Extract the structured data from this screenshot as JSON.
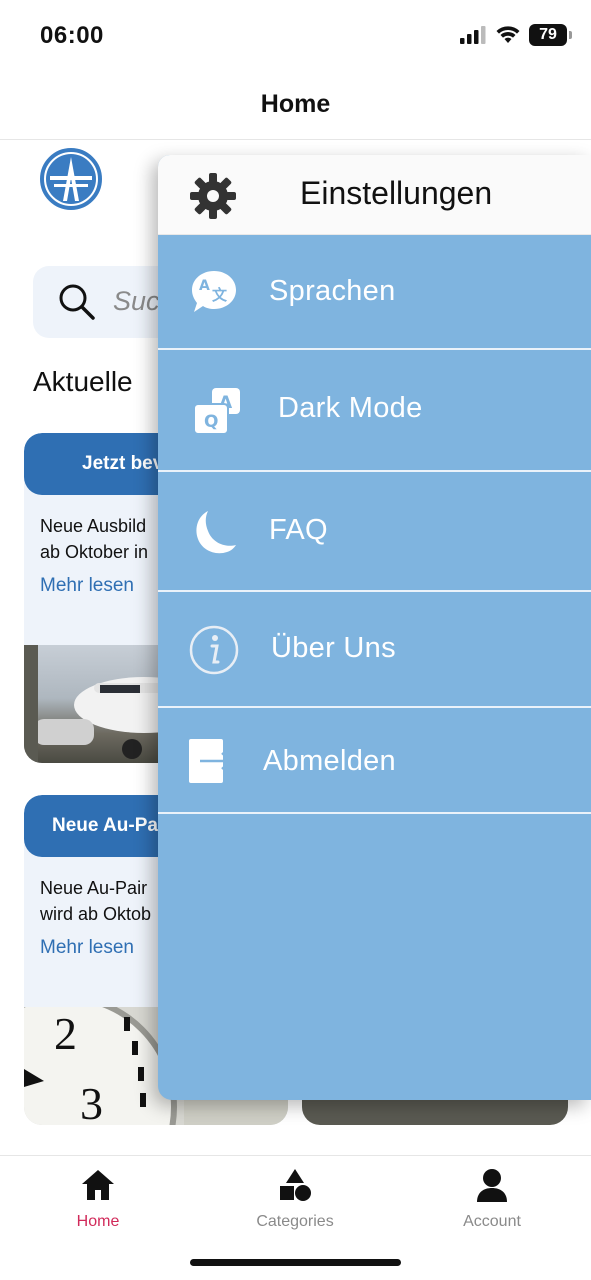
{
  "status_bar": {
    "time": "06:00",
    "battery": "79"
  },
  "header": {
    "title": "Home"
  },
  "search": {
    "placeholder": "Suc"
  },
  "section": {
    "title": "Aktuelle"
  },
  "cards": [
    {
      "title": "Jetzt bev",
      "text_line1": "Neue Ausbild",
      "text_line2": "ab Oktober in",
      "link": "Mehr lesen"
    },
    {
      "title": "Neue Au-Pa",
      "text_line1": "Neue Au-Pair",
      "text_line2": "wird ab Oktob",
      "link": "Mehr lesen"
    }
  ],
  "drawer": {
    "title": "Einstellungen",
    "items": [
      {
        "label": "Sprachen",
        "icon": "translate-icon"
      },
      {
        "label": "Dark Mode",
        "icon": "qa-cards-icon"
      },
      {
        "label": "FAQ",
        "icon": "moon-icon"
      },
      {
        "label": "Über Uns",
        "icon": "info-icon"
      },
      {
        "label": "Abmelden",
        "icon": "logout-icon"
      }
    ]
  },
  "tabs": [
    {
      "label": "Home",
      "icon": "home-icon",
      "active": true
    },
    {
      "label": "Categories",
      "icon": "shapes-icon",
      "active": false
    },
    {
      "label": "Account",
      "icon": "person-icon",
      "active": false
    }
  ],
  "colors": {
    "drawer_bg": "#7fb4df",
    "brand_blue": "#2f6fb3",
    "active_tab": "#d12a5a"
  }
}
